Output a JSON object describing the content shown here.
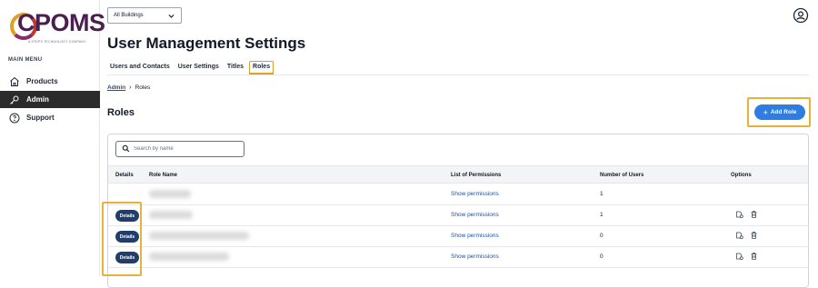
{
  "sidebar": {
    "logo_text": "CPOMS",
    "logo_subtext": "A STEPS TECHNOLOGY COMPANY",
    "menu_title": "MAIN MENU",
    "items": [
      {
        "label": "Products",
        "icon": "home-icon"
      },
      {
        "label": "Admin",
        "icon": "key-icon",
        "active": true
      },
      {
        "label": "Support",
        "icon": "help-circle-icon"
      }
    ]
  },
  "header": {
    "building_select": "All Buildings",
    "page_title": "User Management Settings"
  },
  "tabs": [
    {
      "label": "Users and Contacts"
    },
    {
      "label": "User Settings"
    },
    {
      "label": "Titles"
    },
    {
      "label": "Roles",
      "active": true
    }
  ],
  "breadcrumb": {
    "parent": "Admin",
    "current": "Roles"
  },
  "section": {
    "title": "Roles",
    "add_button": "Add Role"
  },
  "search": {
    "placeholder": "Search by name"
  },
  "table": {
    "columns": [
      "Details",
      "Role Name",
      "List of Permissions",
      "Number of Users",
      "Options"
    ],
    "rows": [
      {
        "details": "",
        "permissions": "Show permissions",
        "users": "1",
        "options": false
      },
      {
        "details": "Details",
        "permissions": "Show permissions",
        "users": "1",
        "options": true
      },
      {
        "details": "Details",
        "permissions": "Show permissions",
        "users": "0",
        "options": true
      },
      {
        "details": "Details",
        "permissions": "Show permissions",
        "users": "0",
        "options": true
      }
    ]
  },
  "colors": {
    "accent": "#2f7de1",
    "highlight": "#e8b13a",
    "details_button": "#213d6b",
    "active_nav": "#2b2b2b"
  }
}
